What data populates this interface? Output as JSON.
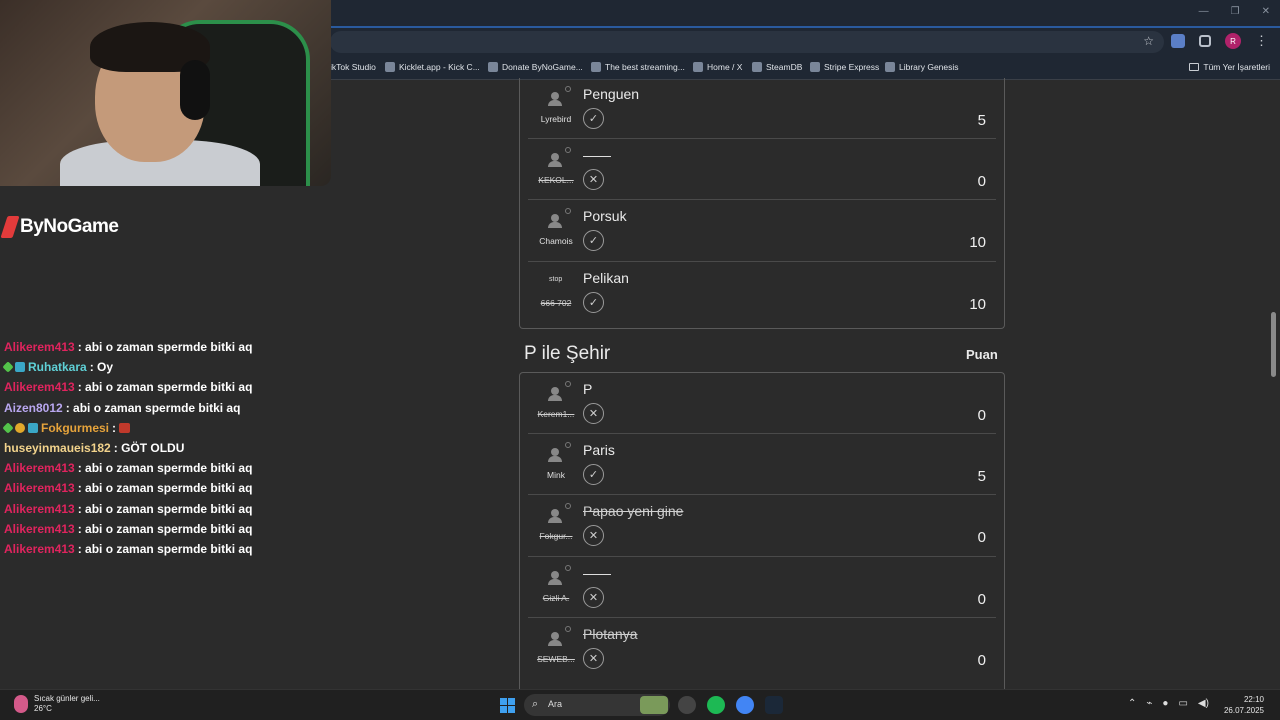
{
  "browser": {
    "bookmarks": [
      {
        "label": "ikTok Studio",
        "icon": "tiktok-icon"
      },
      {
        "label": "Kicklet.app - Kick C...",
        "icon": "kicklet-icon"
      },
      {
        "label": "Donate ByNoGame...",
        "icon": "donate-icon"
      },
      {
        "label": "The best streaming...",
        "icon": "streaming-icon"
      },
      {
        "label": "Home / X",
        "icon": "x-icon"
      },
      {
        "label": "SteamDB",
        "icon": "steamdb-icon"
      },
      {
        "label": "Stripe Express",
        "icon": "stripe-icon"
      },
      {
        "label": "Library Genesis",
        "icon": "libgen-icon"
      }
    ],
    "all_bookmarks": "Tüm Yer İşaretleri",
    "profile_initial": "R"
  },
  "overlay": {
    "logo_text": "ByNoGame"
  },
  "chat": [
    {
      "user": "Alikerem413",
      "color": "#e0245e",
      "badges": [],
      "msg": ": abi o zaman spermde bitki aq"
    },
    {
      "user": "Ruhatkara",
      "color": "#5fd0d6",
      "badges": [
        "green",
        "blue"
      ],
      "msg": ": Oy"
    },
    {
      "user": "Alikerem413",
      "color": "#e0245e",
      "badges": [],
      "msg": ": abi o zaman spermde bitki aq"
    },
    {
      "user": "Aizen8012",
      "color": "#b9a7f0",
      "badges": [],
      "msg": ": abi o zaman spermde bitki aq"
    },
    {
      "user": "Fokgurmesi",
      "color": "#e6a33b",
      "badges": [
        "green",
        "gold",
        "blue"
      ],
      "msg": ":",
      "emote": true
    },
    {
      "user": "huseyinmaueis182",
      "color": "#f2d38c",
      "badges": [],
      "msg": ": GÖT OLDU"
    },
    {
      "user": "Alikerem413",
      "color": "#e0245e",
      "badges": [],
      "msg": ": abi o zaman spermde bitki aq"
    },
    {
      "user": "Alikerem413",
      "color": "#e0245e",
      "badges": [],
      "msg": ": abi o zaman spermde bitki aq"
    },
    {
      "user": "Alikerem413",
      "color": "#e0245e",
      "badges": [],
      "msg": ": abi o zaman spermde bitki aq"
    },
    {
      "user": "Alikerem413",
      "color": "#e0245e",
      "badges": [],
      "msg": ": abi o zaman spermde bitki aq"
    },
    {
      "user": "Alikerem413",
      "color": "#e0245e",
      "badges": [],
      "msg": ": abi o zaman spermde bitki aq"
    }
  ],
  "section1": {
    "rows": [
      {
        "player": "Lyrebird",
        "player_struck": false,
        "word": "Penguen",
        "word_struck": false,
        "verdict": "check",
        "score": "5"
      },
      {
        "player": "KEKOL...",
        "player_struck": true,
        "word": "——",
        "word_struck": false,
        "verdict": "cross",
        "score": "0"
      },
      {
        "player": "Chamois",
        "player_struck": false,
        "word": "Porsuk",
        "word_struck": false,
        "verdict": "check",
        "score": "10"
      },
      {
        "player": "666 702",
        "player_struck": true,
        "word": "Pelikan",
        "word_struck": false,
        "verdict": "check",
        "score": "10",
        "stop": "stop"
      }
    ]
  },
  "section2": {
    "title": "P ile Şehir",
    "score_header": "Puan",
    "rows": [
      {
        "player": "Kerem1...",
        "player_struck": true,
        "word": "P",
        "word_struck": false,
        "verdict": "cross",
        "score": "0"
      },
      {
        "player": "Mink",
        "player_struck": false,
        "word": "Paris",
        "word_struck": false,
        "verdict": "check",
        "score": "5"
      },
      {
        "player": "Fokgur...",
        "player_struck": true,
        "word": "Papao yeni gine",
        "word_struck": true,
        "verdict": "cross",
        "score": "0"
      },
      {
        "player": "Gizli A.",
        "player_struck": true,
        "word": "——",
        "word_struck": false,
        "verdict": "cross",
        "score": "0"
      },
      {
        "player": "SEWEB...",
        "player_struck": true,
        "word": "Plotanya",
        "word_struck": true,
        "verdict": "cross",
        "score": "0"
      }
    ]
  },
  "taskbar": {
    "weather_text": "Sıcak günler geli...",
    "weather_temp": "26°C",
    "search_placeholder": "Ara",
    "time": "22:10",
    "date": "26.07.2025"
  }
}
